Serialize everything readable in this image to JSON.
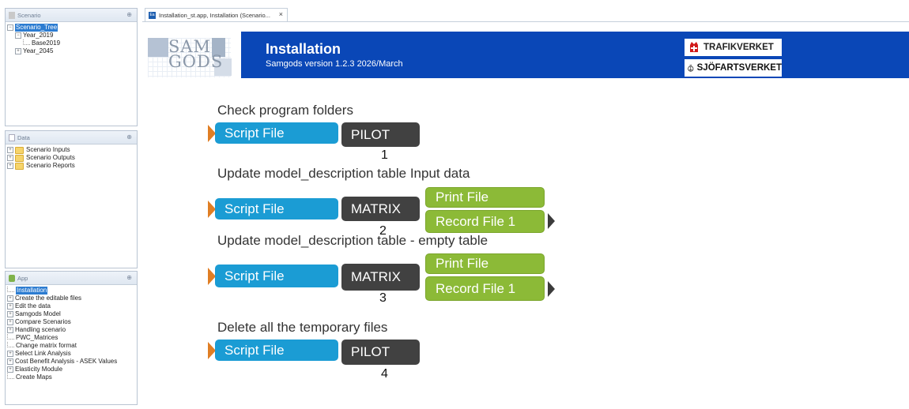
{
  "panels": {
    "scenario": {
      "title": "Scenario",
      "tree": {
        "root": "Scenario_Tree",
        "y2019": "Year_2019",
        "base": "Base2019",
        "y2045": "Year_2045"
      }
    },
    "data": {
      "title": "Data",
      "items": [
        "Scenario Inputs",
        "Scenario Outputs",
        "Scenario Reports"
      ]
    },
    "app": {
      "title": "App",
      "items": [
        "Installation",
        "Create the editable files",
        "Edit the data",
        "Samgods Model",
        "Compare Scenarios",
        "Handling scenario",
        "PWC_Matrices",
        "Change matrix format",
        "Select Link Analysis",
        "Cost Benefit Analysis - ASEK Values",
        "Elasticity Module",
        "Create Maps"
      ]
    }
  },
  "tab": {
    "label": "Installation_st.app, Installation (Scenario...",
    "close": "×",
    "icon_text": "Ea"
  },
  "banner": {
    "logo": "SAM\nGODS",
    "title": "Installation",
    "subtitle": "Samgods version 1.2.3 2026/March",
    "agency1": "TRAFIKVERKET",
    "agency2": "SJÖFARTSVERKET",
    "bg_color": "#0a47b7"
  },
  "steps": [
    {
      "heading": "Check program folders",
      "script": "Script File",
      "program": "PILOT",
      "number": "1"
    },
    {
      "heading": "Update model_description table Input data",
      "script": "Script File",
      "program": "MATRIX",
      "out1": "Print File",
      "out2": "Record File 1",
      "number": "2"
    },
    {
      "heading": "Update model_description table - empty table",
      "script": "Script File",
      "program": "MATRIX",
      "out1": "Print File",
      "out2": "Record File 1",
      "number": "3"
    },
    {
      "heading": "Delete all the temporary files",
      "script": "Script File",
      "program": "PILOT",
      "number": "4"
    }
  ],
  "colors": {
    "script": "#1b9cd4",
    "program": "#414141",
    "output": "#8cba37",
    "arrow": "#e07e24"
  }
}
